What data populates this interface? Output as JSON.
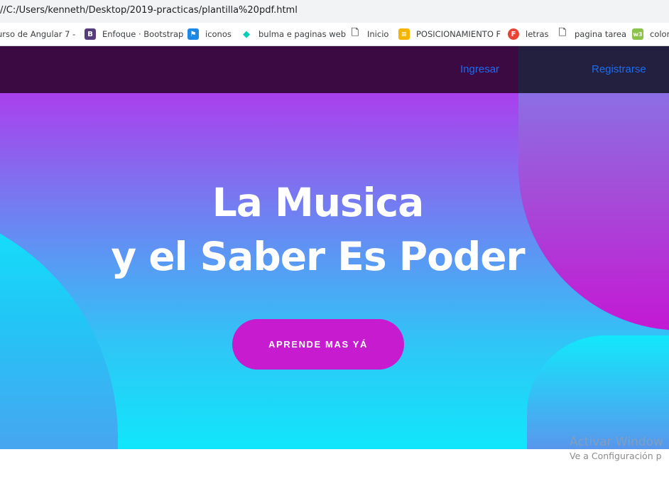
{
  "browser": {
    "url": "//C:/Users/kenneth/Desktop/2019-practicas/plantilla%20pdf.html",
    "bookmarks": [
      {
        "label": "urso de Angular 7 -",
        "icon": "none"
      },
      {
        "label": "Enfoque · Bootstrap",
        "icon": "bootstrap-icon",
        "glyph": "B"
      },
      {
        "label": "iconos",
        "icon": "flag-icon",
        "glyph": "⚑"
      },
      {
        "label": "bulma e paginas web",
        "icon": "bulma-icon",
        "glyph": "◆"
      },
      {
        "label": "Inicio",
        "icon": "page-icon",
        "glyph": "🗋"
      },
      {
        "label": "POSICIONAMIENTO F",
        "icon": "stack-icon",
        "glyph": "≡"
      },
      {
        "label": "letras",
        "icon": "font-icon",
        "glyph": "F"
      },
      {
        "label": "pagina tarea",
        "icon": "page-icon",
        "glyph": "🗋"
      },
      {
        "label": "color",
        "icon": "color-icon",
        "glyph": "w3"
      }
    ]
  },
  "nav": {
    "login": "Ingresar",
    "register": "Registrarse"
  },
  "hero": {
    "title_line1": "La Musica",
    "title_line2": "y el Saber Es Poder",
    "cta": "APRENDE MAS YÁ"
  },
  "windows_watermark": {
    "line1": "Activar Window",
    "line2": "Ve a Configuración p"
  },
  "colors": {
    "nav_bg": "#3c0a42",
    "nav_right_bg": "#23203f",
    "link": "#1a6cf0",
    "cta_bg": "#c71bd0",
    "gradient_top": "#c026ee",
    "gradient_bottom": "#10e6fb"
  }
}
